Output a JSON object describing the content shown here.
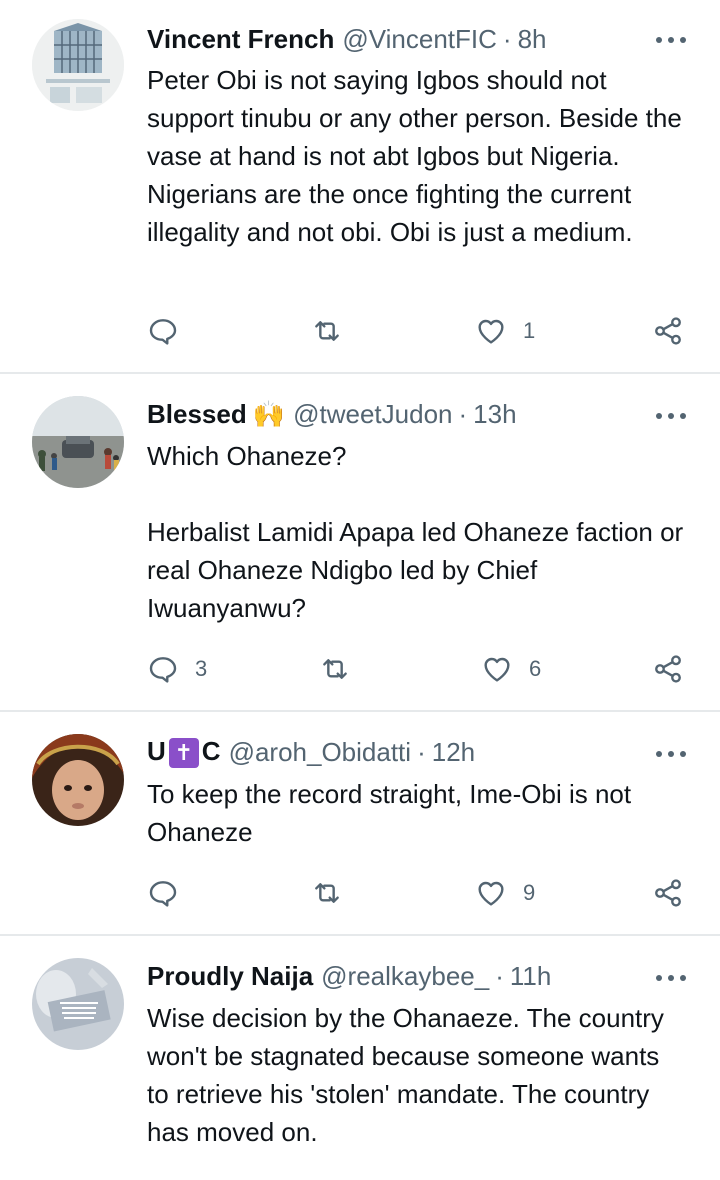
{
  "tweets": [
    {
      "name": "Vincent French",
      "handle": "@VincentFIC",
      "sep": "·",
      "time": "8h",
      "text": "Peter Obi is not saying Igbos should not support tinubu or any other person. Beside the vase at hand is not abt Igbos but Nigeria. Nigerians are the once fighting the current illegality and not obi. Obi is just a medium.",
      "replies": "",
      "retweets": "",
      "likes": "1"
    },
    {
      "name": "Blessed",
      "name_emoji": "🙌",
      "handle": "@tweetJudon",
      "sep": "·",
      "time": "13h",
      "text": "Which Ohaneze?\n\nHerbalist Lamidi Apapa led Ohaneze faction or real Ohaneze Ndigbo led by Chief Iwuanyanwu?",
      "replies": "3",
      "retweets": "",
      "likes": "6"
    },
    {
      "name_prefix": "U",
      "name_badge": "✝",
      "name_suffix": "C",
      "handle": "@aroh_Obidatti",
      "sep": "·",
      "time": "12h",
      "text": "To keep the record straight, Ime-Obi is not Ohaneze",
      "replies": "",
      "retweets": "",
      "likes": "9"
    },
    {
      "name": "Proudly Naija",
      "handle": "@realkaybee_",
      "sep": "·",
      "time": "11h",
      "text": "Wise decision by the Ohanaeze. The country won't be stagnated because someone wants to retrieve his 'stolen' mandate. The country has moved on.",
      "replies": "",
      "retweets": "",
      "likes": ""
    }
  ],
  "icons": {
    "reply": "reply-icon",
    "retweet": "retweet-icon",
    "like": "heart-icon",
    "share": "share-icon",
    "more": "more-icon"
  },
  "colors": {
    "text": "#0f1419",
    "secondary": "#536471",
    "divider": "#e6e9eb"
  }
}
